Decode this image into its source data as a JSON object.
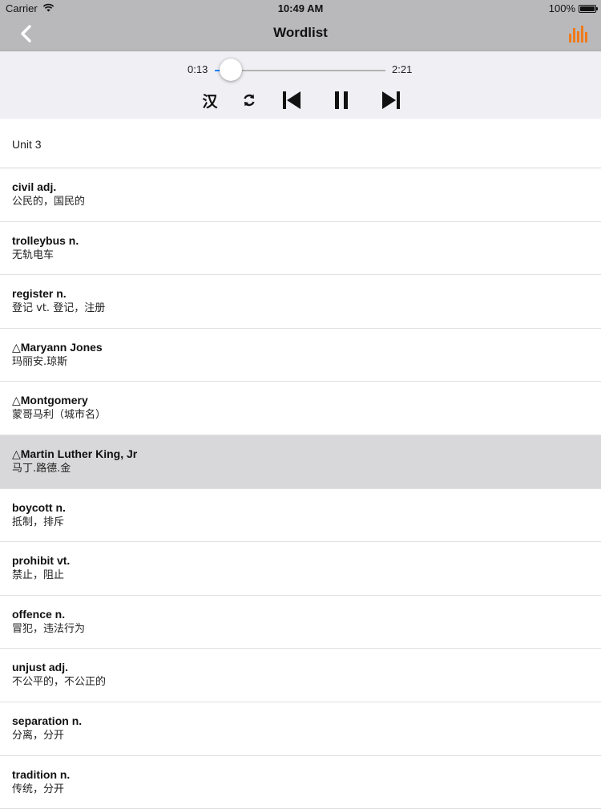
{
  "status_bar": {
    "carrier": "Carrier",
    "time": "10:49 AM",
    "battery": "100%"
  },
  "nav": {
    "title": "Wordlist",
    "back_icon": "chevron-left-icon",
    "equalizer_icon": "equalizer-icon",
    "accent_color": "#f07a1a"
  },
  "player": {
    "elapsed": "0:13",
    "total": "2:21",
    "progress": 0.092,
    "chinese_toggle_label": "汉",
    "accent_color": "#1a84ff",
    "icons": [
      "repeat-icon",
      "skip-previous-icon",
      "pause-icon",
      "skip-next-icon"
    ]
  },
  "list": {
    "section_title": "Unit 3",
    "selected_color": "#d8d8da",
    "items": [
      {
        "term": "civil adj.",
        "meaning": "公民的，国民的"
      },
      {
        "term": "trolleybus n.",
        "meaning": "无轨电车"
      },
      {
        "term": "register n.",
        "meaning": "登记 vt. 登记，注册"
      },
      {
        "term": "△Maryann Jones",
        "meaning": "玛丽安.琼斯"
      },
      {
        "term": "△Montgomery",
        "meaning": "蒙哥马利（城市名）"
      },
      {
        "term": "△Martin Luther King, Jr",
        "meaning": "马丁.路德.金"
      },
      {
        "term": "boycott n.",
        "meaning": "抵制，排斥"
      },
      {
        "term": "prohibit vt.",
        "meaning": "禁止，阻止"
      },
      {
        "term": "offence n.",
        "meaning": "冒犯，违法行为"
      },
      {
        "term": "unjust adj.",
        "meaning": "不公平的，不公正的"
      },
      {
        "term": "separation n.",
        "meaning": "分离，分开"
      },
      {
        "term": "tradition n.",
        "meaning": "传统，分开"
      }
    ]
  }
}
